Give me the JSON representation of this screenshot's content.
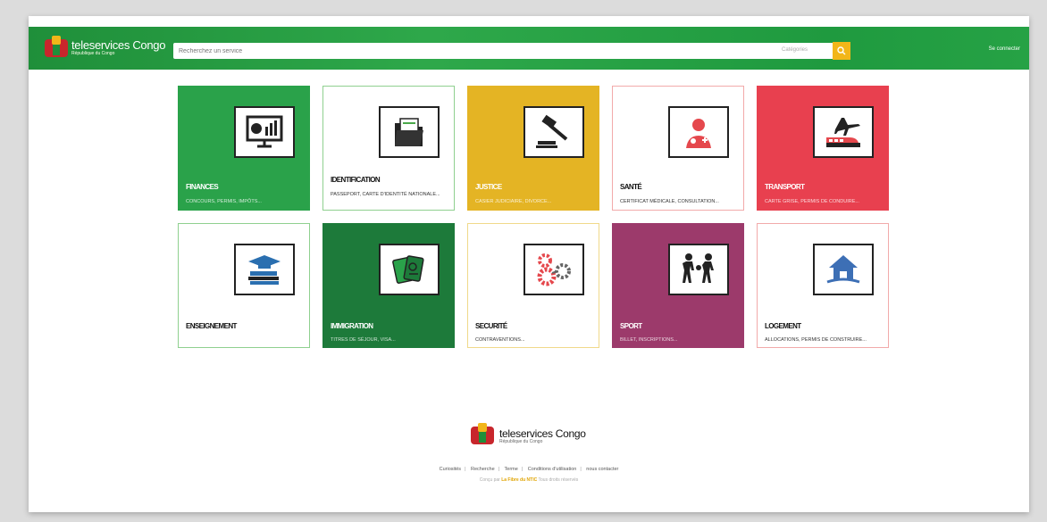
{
  "colors": {
    "green_header": "#2ea84a",
    "yellow_accent": "#f2b619"
  },
  "header": {
    "logo_title": "teleservices Congo",
    "logo_sub": "République du Congo",
    "search_placeholder": "Recherchez un service",
    "category_label": "Catégories",
    "login_link": "Se connecter"
  },
  "tiles": [
    {
      "title": "FINANCES",
      "subtitle": "CONCOURS, PERMIS, IMPÔTS...",
      "style": "solid",
      "bg": "#2aa24a",
      "icon": "finance-chart-icon"
    },
    {
      "title": "IDENTIFICATION",
      "subtitle": "PASSEPORT, CARTE D'IDENTITÉ NATIONALE...",
      "style": "light",
      "border": "#8fd08f",
      "icon": "folder-documents-icon"
    },
    {
      "title": "JUSTICE",
      "subtitle": "CASIER JUDICIAIRE, DIVORCE...",
      "style": "solid",
      "bg": "#e4b424",
      "icon": "gavel-icon"
    },
    {
      "title": "SANTÉ",
      "subtitle": "CERTIFICAT MÉDICALE, CONSULTATION...",
      "style": "light",
      "border": "#f2aaaa",
      "icon": "doctor-icon"
    },
    {
      "title": "TRANSPORT",
      "subtitle": "CARTE GRISE, PERMIS DE CONDUIRE...",
      "style": "solid",
      "bg": "#e8404f",
      "icon": "transport-icon"
    },
    {
      "title": "ENSEIGNEMENT",
      "subtitle": "",
      "style": "light",
      "border": "#8fd08f",
      "icon": "graduation-books-icon"
    },
    {
      "title": "IMMIGRATION",
      "subtitle": "TITRES DE SÉJOUR, VISA...",
      "style": "solid",
      "bg": "#1d7a3a",
      "icon": "passport-icon"
    },
    {
      "title": "SECURITÉ",
      "subtitle": "CONTRAVENTIONS...",
      "style": "light",
      "border": "#f0d98a",
      "icon": "gears-icon"
    },
    {
      "title": "SPORT",
      "subtitle": "BILLET, INSCRIPTIONS...",
      "style": "solid",
      "bg": "#9c3a6b",
      "icon": "football-players-icon"
    },
    {
      "title": "LOGEMENT",
      "subtitle": "ALLOCATIONS, PERMIS DE CONSTRUIRE...",
      "style": "light",
      "border": "#f2aaaa",
      "icon": "house-icon"
    }
  ],
  "footer": {
    "logo_title": "teleservices Congo",
    "logo_sub": "République du Congo",
    "links": [
      "Curiosités",
      "Recherche",
      "Terme",
      "Conditions d'utilisation",
      "nous contacter"
    ],
    "credit_prefix": "Conçu par",
    "credit_accent": "La Fibre du NTIC",
    "credit_suffix": "Tous droits réservés"
  }
}
